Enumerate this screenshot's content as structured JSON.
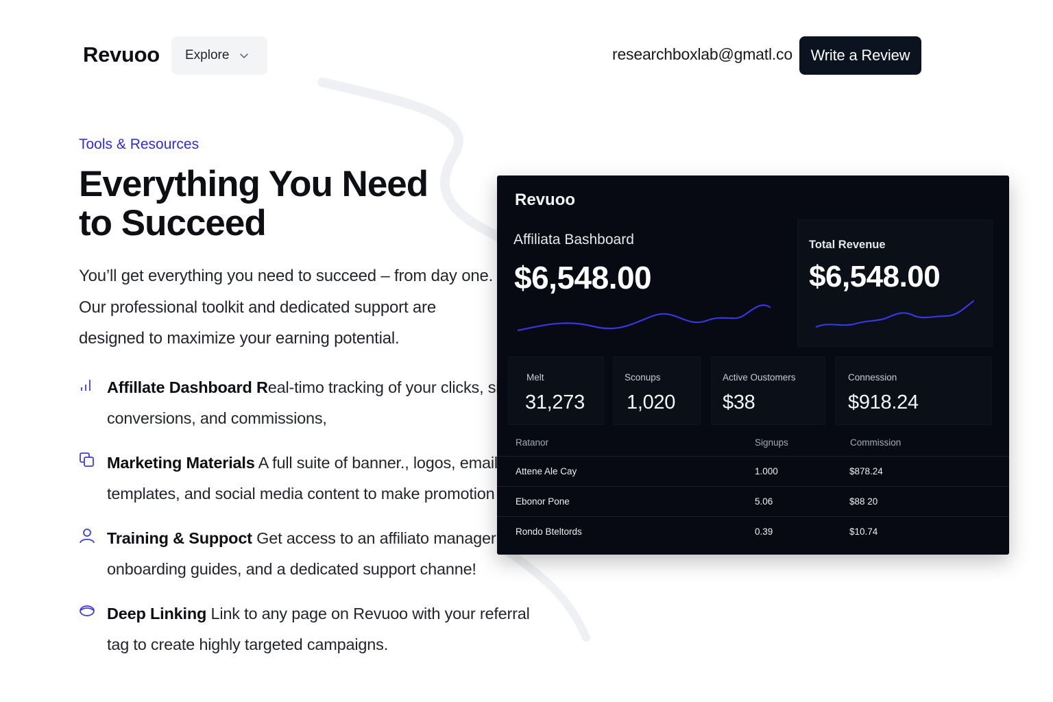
{
  "header": {
    "logo": "Revuoo",
    "explore_label": "Explore",
    "email": "researchboxlab@gmatl.co",
    "review_label": "Write a Review"
  },
  "hero": {
    "eyebrow": "Tools & Resources",
    "headline_line1": "Everything You Need",
    "headline_line2": "to Succeed",
    "intro": "You’ll get everything you need to succeed – from day one. Our professional toolkit and dedicated support are designed to maximize your earning potential."
  },
  "features": [
    {
      "icon": "bar-chart-icon",
      "title": "Affillate Dashboard R",
      "text": "eal-timo tracking of your clicks, signups, conversions, and commissions,"
    },
    {
      "icon": "copy-icon",
      "title": "Marketing Materials",
      "text": " A full suite of banner., logos, email templates, and social media content to make promotion s"
    },
    {
      "icon": "user-icon",
      "title": "Training & Suppoct",
      "text": " Get access to an affiliato manager onboarding guides, and a dedicated support channe!"
    },
    {
      "icon": "link-icon",
      "title": "Deep Linking",
      "text": " Link to any page on Revuoo with your referral tag to create highly targeted campaigns."
    }
  ],
  "dashboard": {
    "logo": "Revuoo",
    "left_title": "Affiliata Bashboard",
    "left_value": "$6,548.00",
    "right_title": "Total Revenue",
    "right_value": "$6,548.00",
    "accent_color": "#3b3be6",
    "stats": [
      {
        "label": "Melt",
        "value": "31,273"
      },
      {
        "label": "Sconups",
        "value": "1,020"
      },
      {
        "label": "Active Oustomers",
        "value": "$38"
      },
      {
        "label": "Connession",
        "value": "$918.24"
      }
    ],
    "table": {
      "headers": [
        "Ratanor",
        "Signups",
        "Commission"
      ],
      "rows": [
        [
          "Attene Ale Cay",
          "1.000",
          "$878.24"
        ],
        [
          "Ebonor Pone",
          "5.06",
          "$88 20"
        ],
        [
          "Rondo Bteltords",
          "0.39",
          "$10.74"
        ]
      ]
    }
  }
}
